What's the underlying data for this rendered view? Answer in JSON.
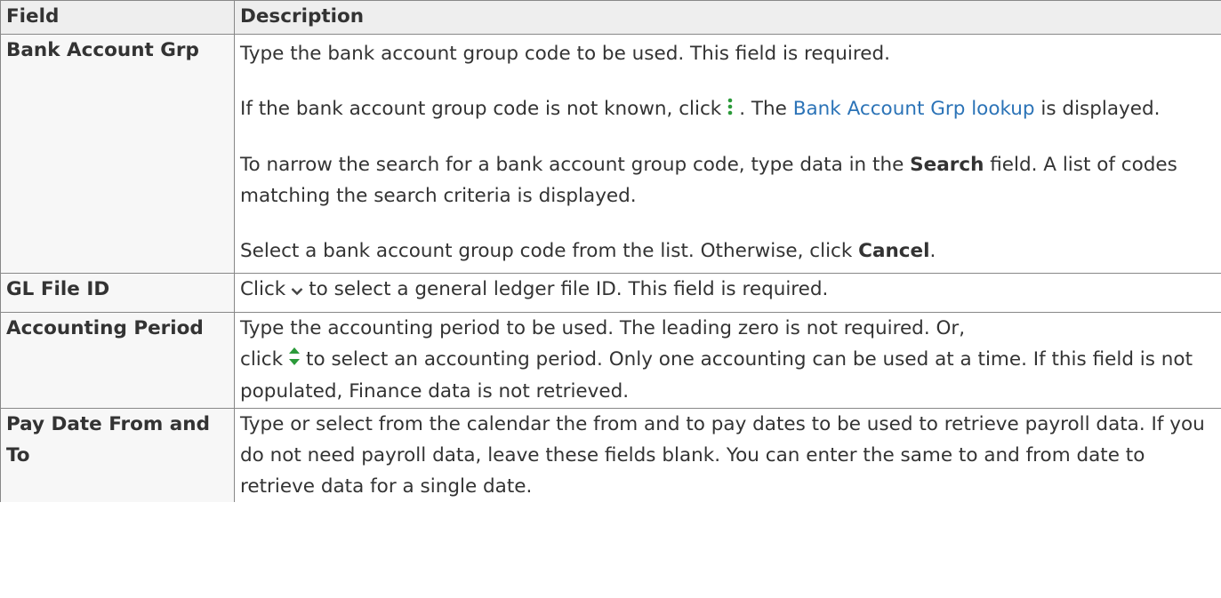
{
  "table": {
    "headers": {
      "field": "Field",
      "description": "Description"
    },
    "rows": [
      {
        "label": "Bank Account Grp",
        "p1": "Type the bank account group code to be used. This field is required.",
        "p2_before": "If the bank account group code is not known, click",
        "p2_mid": ". The",
        "p2_link": "Bank Account Grp lookup",
        "p2_after": "is displayed.",
        "p3_before": "To narrow the search for a bank account group code, type data in the",
        "p3_bold": "Search",
        "p3_after": "field. A list of codes matching the search criteria is displayed.",
        "p4_before": "Select a bank account group code from the list. Otherwise, click",
        "p4_bold": "Cancel",
        "p4_after": "."
      },
      {
        "label": "GL File ID",
        "before": "Click",
        "after": "to select a general ledger file ID. This field is required."
      },
      {
        "label": "Accounting Period",
        "line1": "Type the accounting period to be used. The leading zero is not required. Or,",
        "before": "click",
        "after": "to select an accounting period. Only one accounting can be used at a time. If this field is not populated, Finance data is not retrieved."
      },
      {
        "label": "Pay Date From and To",
        "text": "Type or select from the calendar the from and to pay dates to be used to retrieve payroll data. If you do not need payroll data, leave these fields blank. You can enter the same to and from date to retrieve data for a single date."
      }
    ]
  },
  "icons": {
    "lookup": "vertical-ellipsis-icon",
    "dropdown": "chevron-down-icon",
    "spinner": "up-down-arrows-icon",
    "accent_color": "#2b9a3a",
    "link_color": "#2b73b7"
  }
}
